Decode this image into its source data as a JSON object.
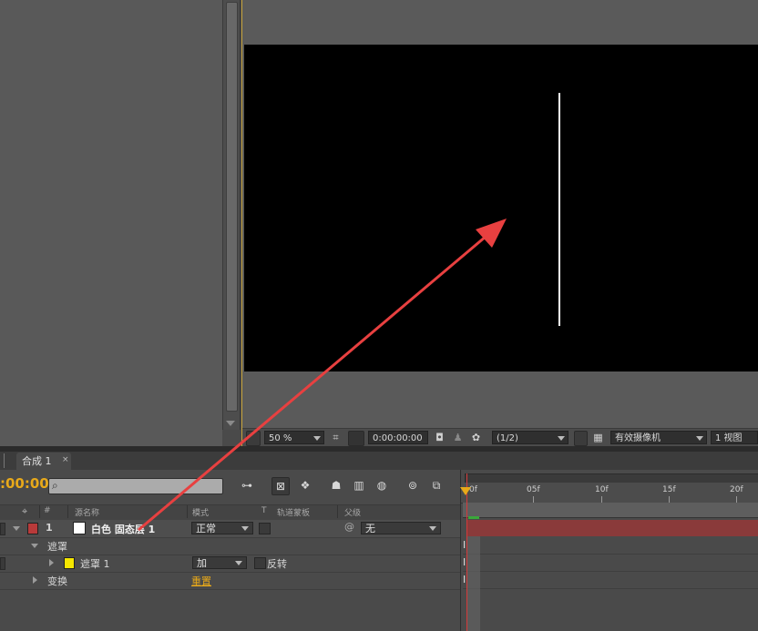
{
  "viewer": {
    "zoom": "50 %",
    "timecode": "0:00:00:00",
    "resolution": "(1/2)",
    "camera": "有效摄像机",
    "views": "1 视图"
  },
  "timeline": {
    "tab_label": "合成 1",
    "tab_close": "×",
    "timecode": ":00:00",
    "columns": {
      "number": "#",
      "source_name": "源名称",
      "mode": "模式",
      "t": "T",
      "track_matte": "轨道蒙板",
      "parent": "父级"
    },
    "layer": {
      "index": "1",
      "name": "白色 固态层 1",
      "mode": "正常",
      "parent": "无",
      "label_color": "#b83a3a",
      "swatch_color": "#ffffff"
    },
    "masks_group": "遮罩",
    "mask": {
      "name": "遮罩 1",
      "mode": "加",
      "inverted_label": "反转",
      "color": "#f5e600"
    },
    "transform": {
      "label": "变换",
      "reset": "重置"
    },
    "ruler": {
      "ticks": [
        "0f",
        "05f",
        "10f",
        "15f",
        "20f"
      ]
    }
  },
  "colors": {
    "accent": "#e8a91a",
    "layer_bar": "#8a3a3a",
    "arrow": "#e84040"
  }
}
